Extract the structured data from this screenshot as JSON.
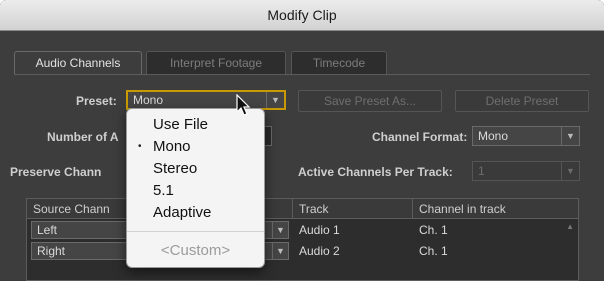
{
  "window": {
    "title": "Modify Clip"
  },
  "tabs": [
    {
      "label": "Audio Channels",
      "active": true
    },
    {
      "label": "Interpret Footage",
      "active": false
    },
    {
      "label": "Timecode",
      "active": false
    }
  ],
  "preset": {
    "label": "Preset:",
    "value": "Mono",
    "save_label": "Save Preset As...",
    "delete_label": "Delete Preset"
  },
  "number_of": {
    "label": "Number of A"
  },
  "channel_format": {
    "label": "Channel Format:",
    "value": "Mono"
  },
  "preserve": {
    "label": "Preserve Chann"
  },
  "active_channels": {
    "label": "Active Channels Per Track:",
    "value": "1"
  },
  "table": {
    "headers": [
      "Source Chann",
      "Track",
      "Channel in track"
    ],
    "rows": [
      {
        "source": "Left",
        "track": "Audio 1",
        "channel": "Ch. 1"
      },
      {
        "source": "Right",
        "track": "Audio 2",
        "channel": "Ch. 1"
      }
    ]
  },
  "preset_menu": {
    "items": [
      {
        "label": "Use File",
        "checked": false
      },
      {
        "label": "Mono",
        "checked": true
      },
      {
        "label": "Stereo",
        "checked": false
      },
      {
        "label": "5.1",
        "checked": false
      },
      {
        "label": "Adaptive",
        "checked": false
      }
    ],
    "custom_label": "<Custom>",
    "check_symbol": "•"
  },
  "icons": {
    "dropdown_arrow": "▼",
    "scroll_up": "▲"
  },
  "colors": {
    "panel": "#3d3d3d",
    "focus": "#c99a00",
    "menu": "#f4f4f4"
  }
}
